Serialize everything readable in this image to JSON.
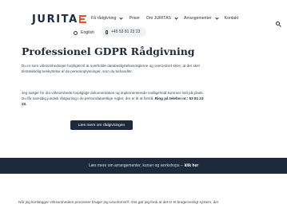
{
  "header": {
    "logo_left": "JURITA",
    "logo_right": "",
    "nav": [
      {
        "label": "Få rådgivning",
        "has_dropdown": true
      },
      {
        "label": "Priser",
        "has_dropdown": false
      },
      {
        "label": "Om JURITAS",
        "has_dropdown": true
      },
      {
        "label": "Arrangementer",
        "has_dropdown": true
      },
      {
        "label": "Kontakt",
        "has_dropdown": false
      }
    ],
    "language": "English",
    "phone": "+45 53 81 23 23",
    "icons": {
      "search": "search-icon",
      "globe": "globe-icon",
      "phone": "phone-icon",
      "chevron": "chevron-down-icon"
    }
  },
  "hero": {
    "title": "Professionel GDPR Rådgivning",
    "paragraph1": "Du er som virksomhedsejer forpligtet til at overholde databeskyttelsesreglerne og overordnet sikre, at der sker tilstrækkelig beskyttelse af de personoplysninger, som du behandler.",
    "paragraph2_text": "Jeg sørger for din virksomheds lovpligtige dokumentation og implementerede vedligehold kommer helt på plads. Du får samtidig juridisk rådgivning i de persondataretlige regler, der er til at forstå.",
    "paragraph2_bold": "Ring på telefon nr.: 53 81 23 23.",
    "button": "Læs mere om rådgivningen"
  },
  "band": {
    "text": "Læs mere om arrangementer, kurser og workshops –",
    "link": "klik her"
  },
  "bottom_text": "Når jeg kortlægger virksomheders processer bruger jeg Lexoforms®. Det gør jeg fordi at det er et brugervenligt system, der",
  "colors": {
    "navy": "#1e2a3c",
    "accent": "#e0552a",
    "band_bg": "#1e2a3c",
    "pill_bg": "#f0f1f3"
  }
}
